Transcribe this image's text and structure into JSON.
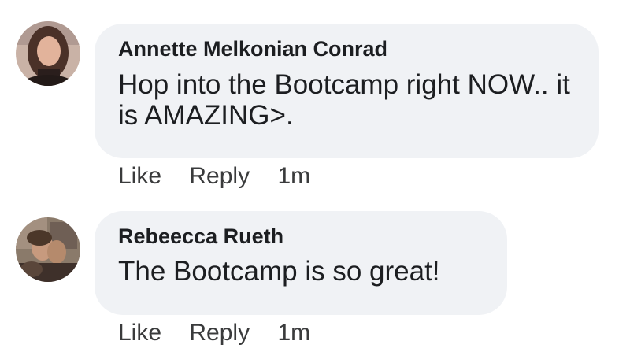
{
  "comments": [
    {
      "author": "Annette Melkonian Conrad",
      "text": "Hop into the Bootcamp right NOW.. it is AMAZING>.",
      "actions": {
        "like": "Like",
        "reply": "Reply",
        "time": "1m"
      }
    },
    {
      "author": "Rebeecca Rueth",
      "text": "The Bootcamp is so great!",
      "actions": {
        "like": "Like",
        "reply": "Reply",
        "time": "1m"
      }
    }
  ],
  "colors": {
    "bubble_bg": "#f0f2f5",
    "text": "#1c1e21",
    "action_text": "#3a3b3c"
  }
}
